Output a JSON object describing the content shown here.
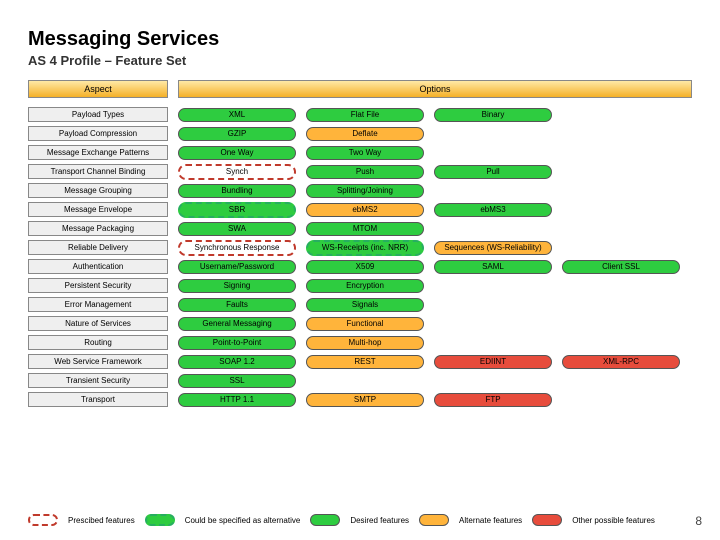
{
  "title": "Messaging Services",
  "subtitle": "AS 4 Profile – Feature Set",
  "page_number": "8",
  "headers": {
    "aspect": "Aspect",
    "options": "Options"
  },
  "legend": [
    {
      "style": "prescribed",
      "label": "Prescibed features"
    },
    {
      "style": "alternative",
      "label": "Could be specified as alternative"
    },
    {
      "style": "green",
      "label": "Desired features"
    },
    {
      "style": "orange",
      "label": "Alternate features"
    },
    {
      "style": "red",
      "label": "Other possible features"
    }
  ],
  "rows": [
    {
      "aspect": "Payload Types",
      "options": [
        {
          "label": "XML",
          "style": "green",
          "w": "w1"
        },
        {
          "label": "Flat File",
          "style": "green",
          "w": "w1"
        },
        {
          "label": "Binary",
          "style": "green",
          "w": "w1"
        }
      ]
    },
    {
      "aspect": "Payload Compression",
      "options": [
        {
          "label": "GZIP",
          "style": "green",
          "w": "w1"
        },
        {
          "label": "Deflate",
          "style": "orange",
          "w": "w1"
        }
      ]
    },
    {
      "aspect": "Message Exchange Patterns",
      "options": [
        {
          "label": "One Way",
          "style": "green",
          "w": "w1"
        },
        {
          "label": "Two Way",
          "style": "green",
          "w": "w1"
        }
      ]
    },
    {
      "aspect": "Transport Channel Binding",
      "options": [
        {
          "label": "Synch",
          "style": "prescribed",
          "w": "w1"
        },
        {
          "label": "Push",
          "style": "green",
          "w": "w1"
        },
        {
          "label": "Pull",
          "style": "green",
          "w": "w1"
        }
      ]
    },
    {
      "aspect": "Message Grouping",
      "options": [
        {
          "label": "Bundling",
          "style": "green",
          "w": "w1"
        },
        {
          "label": "Splitting/Joining",
          "style": "green",
          "w": "w1"
        }
      ]
    },
    {
      "aspect": "Message Envelope",
      "options": [
        {
          "label": "SBR",
          "style": "alternative",
          "w": "w1"
        },
        {
          "label": "ebMS2",
          "style": "orange",
          "w": "w1"
        },
        {
          "label": "ebMS3",
          "style": "green",
          "w": "w1"
        }
      ]
    },
    {
      "aspect": "Message Packaging",
      "options": [
        {
          "label": "SWA",
          "style": "green",
          "w": "w1"
        },
        {
          "label": "MTOM",
          "style": "green",
          "w": "w1"
        }
      ]
    },
    {
      "aspect": "Reliable Delivery",
      "options": [
        {
          "label": "Synchronous Response",
          "style": "prescribed",
          "w": "w1"
        },
        {
          "label": "WS-Receipts (inc. NRR)",
          "style": "alternative",
          "w": "w1"
        },
        {
          "label": "Sequences (WS-Reliability)",
          "style": "orange",
          "w": "w1"
        }
      ]
    },
    {
      "aspect": "Authentication",
      "options": [
        {
          "label": "Username/Password",
          "style": "green",
          "w": "w1"
        },
        {
          "label": "X509",
          "style": "green",
          "w": "w1"
        },
        {
          "label": "SAML",
          "style": "green",
          "w": "w1"
        },
        {
          "label": "Client SSL",
          "style": "green",
          "w": "w1"
        }
      ]
    },
    {
      "aspect": "Persistent Security",
      "options": [
        {
          "label": "Signing",
          "style": "green",
          "w": "w1"
        },
        {
          "label": "Encryption",
          "style": "green",
          "w": "w1"
        }
      ]
    },
    {
      "aspect": "Error Management",
      "options": [
        {
          "label": "Faults",
          "style": "green",
          "w": "w1"
        },
        {
          "label": "Signals",
          "style": "green",
          "w": "w1"
        }
      ]
    },
    {
      "aspect": "Nature of Services",
      "options": [
        {
          "label": "General Messaging",
          "style": "green",
          "w": "w1"
        },
        {
          "label": "Functional",
          "style": "orange",
          "w": "w1"
        }
      ]
    },
    {
      "aspect": "Routing",
      "options": [
        {
          "label": "Point-to-Point",
          "style": "green",
          "w": "w1"
        },
        {
          "label": "Multi-hop",
          "style": "orange",
          "w": "w1"
        }
      ]
    },
    {
      "aspect": "Web Service Framework",
      "options": [
        {
          "label": "SOAP 1.2",
          "style": "green",
          "w": "w1"
        },
        {
          "label": "REST",
          "style": "orange",
          "w": "w1"
        },
        {
          "label": "EDIINT",
          "style": "red",
          "w": "w1"
        },
        {
          "label": "XML-RPC",
          "style": "red",
          "w": "w1"
        }
      ]
    },
    {
      "aspect": "Transient Security",
      "options": [
        {
          "label": "SSL",
          "style": "green",
          "w": "w1"
        }
      ]
    },
    {
      "aspect": "Transport",
      "options": [
        {
          "label": "HTTP 1.1",
          "style": "green",
          "w": "w1"
        },
        {
          "label": "SMTP",
          "style": "orange",
          "w": "w1"
        },
        {
          "label": "FTP",
          "style": "red",
          "w": "w1"
        }
      ]
    }
  ]
}
